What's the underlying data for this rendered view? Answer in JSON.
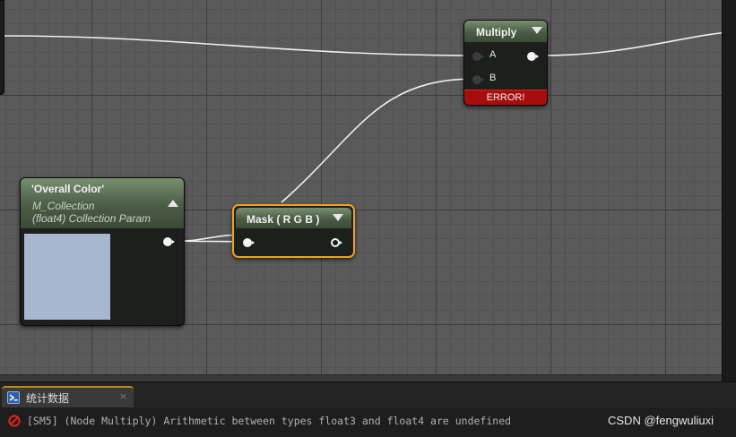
{
  "multiply_node": {
    "title": "Multiply",
    "input_a": "A",
    "input_b": "B",
    "error": "ERROR!"
  },
  "param_node": {
    "title": "'Overall Color'",
    "collection": "M_Collection",
    "type": "(float4) Collection Param",
    "swatch_color": "#a7b7d0"
  },
  "mask_node": {
    "title": "Mask ( R G B )",
    "selected_border_color": "#f2a219"
  },
  "stats_panel": {
    "tab_label": "统计数据",
    "close_glyph": "×",
    "error_message": "[SM5] (Node Multiply) Arithmetic between types float3 and float4 are undefined"
  },
  "watermark": "CSDN @fengwuliuxi",
  "colors": {
    "graph_background": "#5a5a5a",
    "node_header": "#4a5c45",
    "error_bar": "#a80d0d",
    "wire": "#f0f0f0"
  }
}
